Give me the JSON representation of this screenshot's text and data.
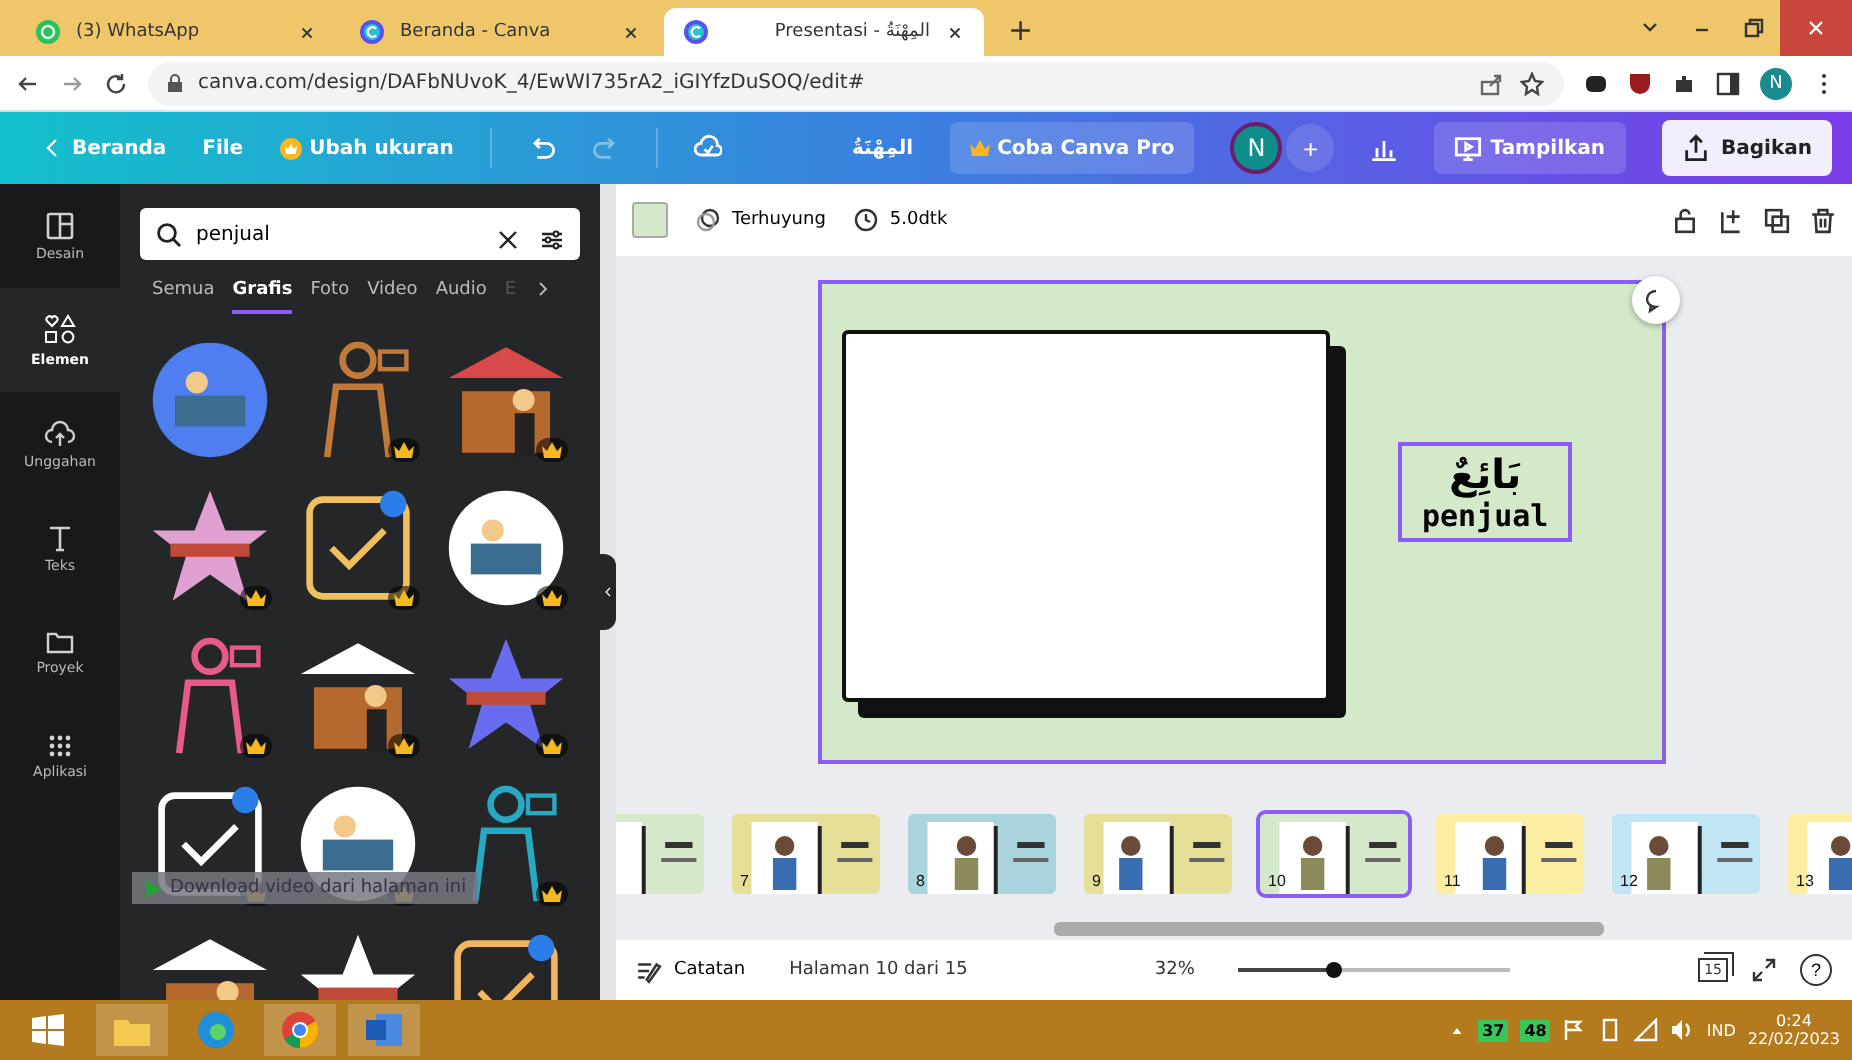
{
  "browser": {
    "tabs": [
      {
        "title": "(3) WhatsApp",
        "kind": "whatsapp",
        "selected": false
      },
      {
        "title": "Beranda - Canva",
        "kind": "canva",
        "selected": false
      },
      {
        "title": "Presentasi - المِهْنَةُ",
        "kind": "canva",
        "selected": true
      }
    ],
    "new_tab": "+",
    "url": "canva.com/design/DAFbNUvoK_4/EwWI735rA2_iGIYfzDuSOQ/edit#",
    "profile": "N"
  },
  "header": {
    "back": "Beranda",
    "file": "File",
    "resize": "Ubah ukuran",
    "title": "المِهْنَةُ",
    "pro": "Coba Canva Pro",
    "avatar": "N",
    "add": "+",
    "present": "Tampilkan",
    "share": "Bagikan"
  },
  "sidebar": {
    "items": [
      {
        "label": "Desain",
        "kind": "layout",
        "selected": false
      },
      {
        "label": "Elemen",
        "kind": "shapes",
        "selected": true
      },
      {
        "label": "Unggahan",
        "kind": "upload",
        "selected": false
      },
      {
        "label": "Teks",
        "kind": "text",
        "selected": false
      },
      {
        "label": "Proyek",
        "kind": "folder",
        "selected": false
      },
      {
        "label": "Aplikasi",
        "kind": "apps",
        "selected": false
      }
    ]
  },
  "panel": {
    "search": {
      "value": "penjual"
    },
    "categories": [
      {
        "label": "Semua",
        "selected": false
      },
      {
        "label": "Grafis",
        "selected": true
      },
      {
        "label": "Foto",
        "selected": false
      },
      {
        "label": "Video",
        "selected": false
      },
      {
        "label": "Audio",
        "selected": false
      },
      {
        "label": "E",
        "selected": false
      }
    ],
    "graphics": [
      {
        "kind": "picture",
        "premium": false
      },
      {
        "kind": "picture",
        "premium": true
      },
      {
        "kind": "picture",
        "premium": true
      },
      {
        "kind": "picture",
        "premium": true
      },
      {
        "kind": "picture",
        "premium": true
      },
      {
        "kind": "picture",
        "premium": true
      },
      {
        "kind": "picture",
        "premium": true
      },
      {
        "kind": "picture",
        "premium": true
      },
      {
        "kind": "picture",
        "premium": true
      },
      {
        "kind": "picture",
        "premium": true
      },
      {
        "kind": "picture",
        "premium": true
      },
      {
        "kind": "picture",
        "premium": true
      },
      {
        "kind": "picture",
        "premium": false
      },
      {
        "kind": "picture",
        "premium": false
      },
      {
        "kind": "picture",
        "premium": false
      }
    ],
    "download_bar": "Download video dari halaman ini"
  },
  "toolbar": {
    "animation": "Terhuyung",
    "duration": "5.0dtk"
  },
  "slide": {
    "title": "بَائِعٌ",
    "subtitle": "penjual"
  },
  "thumbnails": [
    {
      "color": "#d3e9c9",
      "selected": false
    },
    {
      "number": "7",
      "color": "#e6df97",
      "selected": false
    },
    {
      "number": "8",
      "color": "#a9d4dd",
      "selected": false
    },
    {
      "number": "9",
      "color": "#e6df97",
      "selected": false
    },
    {
      "number": "10",
      "color": "#d3e9c9",
      "selected": true
    },
    {
      "number": "11",
      "color": "#fbeea2",
      "selected": false
    },
    {
      "number": "12",
      "color": "#bfe6f2",
      "selected": false
    },
    {
      "number": "13",
      "color": "#fbeea2",
      "selected": false
    }
  ],
  "footer": {
    "notes": "Catatan",
    "page": "Halaman 10 dari 15",
    "zoom": "32%",
    "zoom_slider": {
      "level": 0.35
    },
    "pages": "15",
    "help": "?"
  },
  "taskbar": {
    "battery1": "37",
    "battery2": "48",
    "language": "IND",
    "time": "0:24",
    "date": "22/02/2023"
  }
}
